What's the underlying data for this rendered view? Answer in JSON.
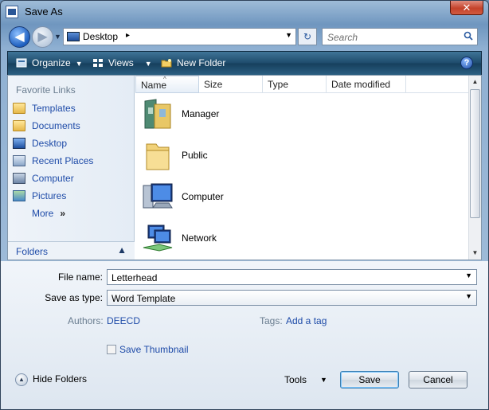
{
  "window": {
    "title": "Save As",
    "close_glyph": "✕"
  },
  "nav": {
    "back_glyph": "◀",
    "forward_glyph": "▶",
    "address_location": "Desktop",
    "address_chevron": "▸",
    "dropdown_glyph": "▼",
    "refresh_glyph": "↻",
    "search_placeholder": "Search"
  },
  "toolbar": {
    "organize_label": "Organize",
    "views_label": "Views",
    "new_folder_label": "New Folder",
    "caret": "▼",
    "help_glyph": "?"
  },
  "favorites": {
    "title": "Favorite Links",
    "items": [
      {
        "label": "Templates",
        "icon": "folder-icon"
      },
      {
        "label": "Documents",
        "icon": "folder-icon"
      },
      {
        "label": "Desktop",
        "icon": "monitor-icon"
      },
      {
        "label": "Recent Places",
        "icon": "recent-places-icon"
      },
      {
        "label": "Computer",
        "icon": "computer-icon"
      },
      {
        "label": "Pictures",
        "icon": "pictures-icon"
      }
    ],
    "more_label": "More",
    "more_glyph": "»",
    "folders_label": "Folders",
    "folders_caret": "▲"
  },
  "columns": [
    "Name",
    "Size",
    "Type",
    "Date modified"
  ],
  "sort_glyph": "^",
  "files": [
    {
      "name": "Manager",
      "icon": "user-folder-icon"
    },
    {
      "name": "Public",
      "icon": "folder-icon"
    },
    {
      "name": "Computer",
      "icon": "computer-icon"
    },
    {
      "name": "Network",
      "icon": "network-icon"
    }
  ],
  "form": {
    "file_name_label": "File name:",
    "file_name_value": "Letterhead",
    "save_type_label": "Save as type:",
    "save_type_value": "Word Template",
    "authors_label": "Authors:",
    "authors_value": "DEECD",
    "tags_label": "Tags:",
    "tags_value": "Add a tag",
    "thumbnail_label": "Save Thumbnail",
    "thumbnail_checked": false
  },
  "footer": {
    "hide_folders_label": "Hide Folders",
    "hide_folders_glyph": "▲",
    "tools_label": "Tools",
    "save_label": "Save",
    "cancel_label": "Cancel"
  },
  "colors": {
    "link_blue": "#1e4ba8",
    "toolbar_dark": "#1d4a6b",
    "close_red": "#c4422b"
  }
}
